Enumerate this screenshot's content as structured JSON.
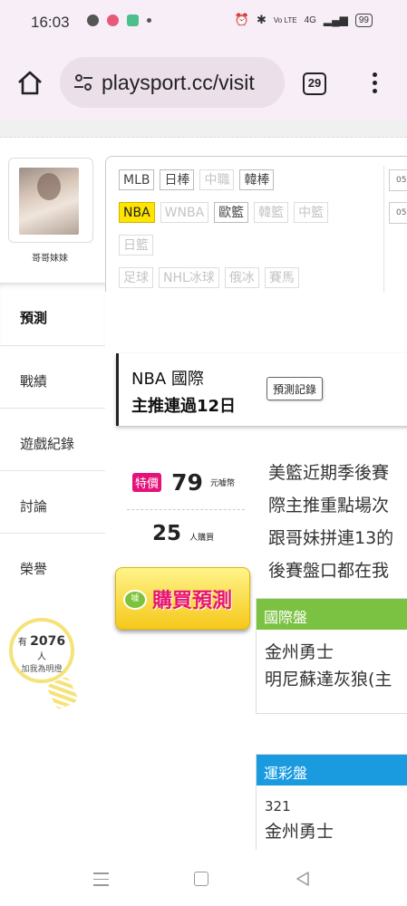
{
  "status_bar": {
    "time": "16:03",
    "network": "4G",
    "volte": "Vo LTE",
    "battery": "99"
  },
  "browser": {
    "url": "playsport.cc/visit",
    "tab_count": "29"
  },
  "profile": {
    "name": "哥哥妹妹"
  },
  "sidebar": {
    "items": [
      {
        "label": "預測",
        "active": true
      },
      {
        "label": "戰績"
      },
      {
        "label": "遊戲紀錄"
      },
      {
        "label": "討論"
      },
      {
        "label": "榮譽"
      }
    ],
    "bulb": {
      "prefix": "有",
      "count": "2076",
      "suffix": "人",
      "subtext": "加我為明燈"
    }
  },
  "sports_tags": {
    "row1": [
      {
        "label": "MLB",
        "state": "on"
      },
      {
        "label": "日棒",
        "state": "on"
      },
      {
        "label": "中職",
        "state": "off"
      },
      {
        "label": "韓棒",
        "state": "on"
      }
    ],
    "row2": [
      {
        "label": "NBA",
        "state": "selected"
      },
      {
        "label": "WNBA",
        "state": "off"
      },
      {
        "label": "歐籃",
        "state": "on"
      },
      {
        "label": "韓籃",
        "state": "off"
      },
      {
        "label": "中籃",
        "state": "off"
      }
    ],
    "row3": [
      {
        "label": "日籃",
        "state": "off"
      }
    ],
    "row4": [
      {
        "label": "足球",
        "state": "off"
      },
      {
        "label": "NHL冰球",
        "state": "off"
      },
      {
        "label": "俄冰",
        "state": "off"
      },
      {
        "label": "賽馬",
        "state": "off"
      }
    ],
    "dates": [
      "05",
      "05"
    ]
  },
  "prediction_card": {
    "league": "NBA 國際",
    "streak": "主推連過12日",
    "record_button": "預測記錄"
  },
  "pricing": {
    "badge": "特價",
    "price": "79",
    "unit": "元噱幣",
    "buyers": "25",
    "buyers_unit": "人購買",
    "buy_button": "購買預測",
    "coin_label": "噱"
  },
  "description": [
    "美籃近期季後賽",
    "際主推重點場次",
    "跟哥妹拼連13的",
    "後賽盤口都在我"
  ],
  "international_box": {
    "title": "國際盤",
    "color": "#7bc142",
    "lines": [
      "金州勇士",
      "明尼蘇達灰狼(主"
    ]
  },
  "lottery_box": {
    "title": "運彩盤",
    "color": "#1a9be0",
    "number": "321",
    "lines": [
      "金州勇士"
    ]
  }
}
